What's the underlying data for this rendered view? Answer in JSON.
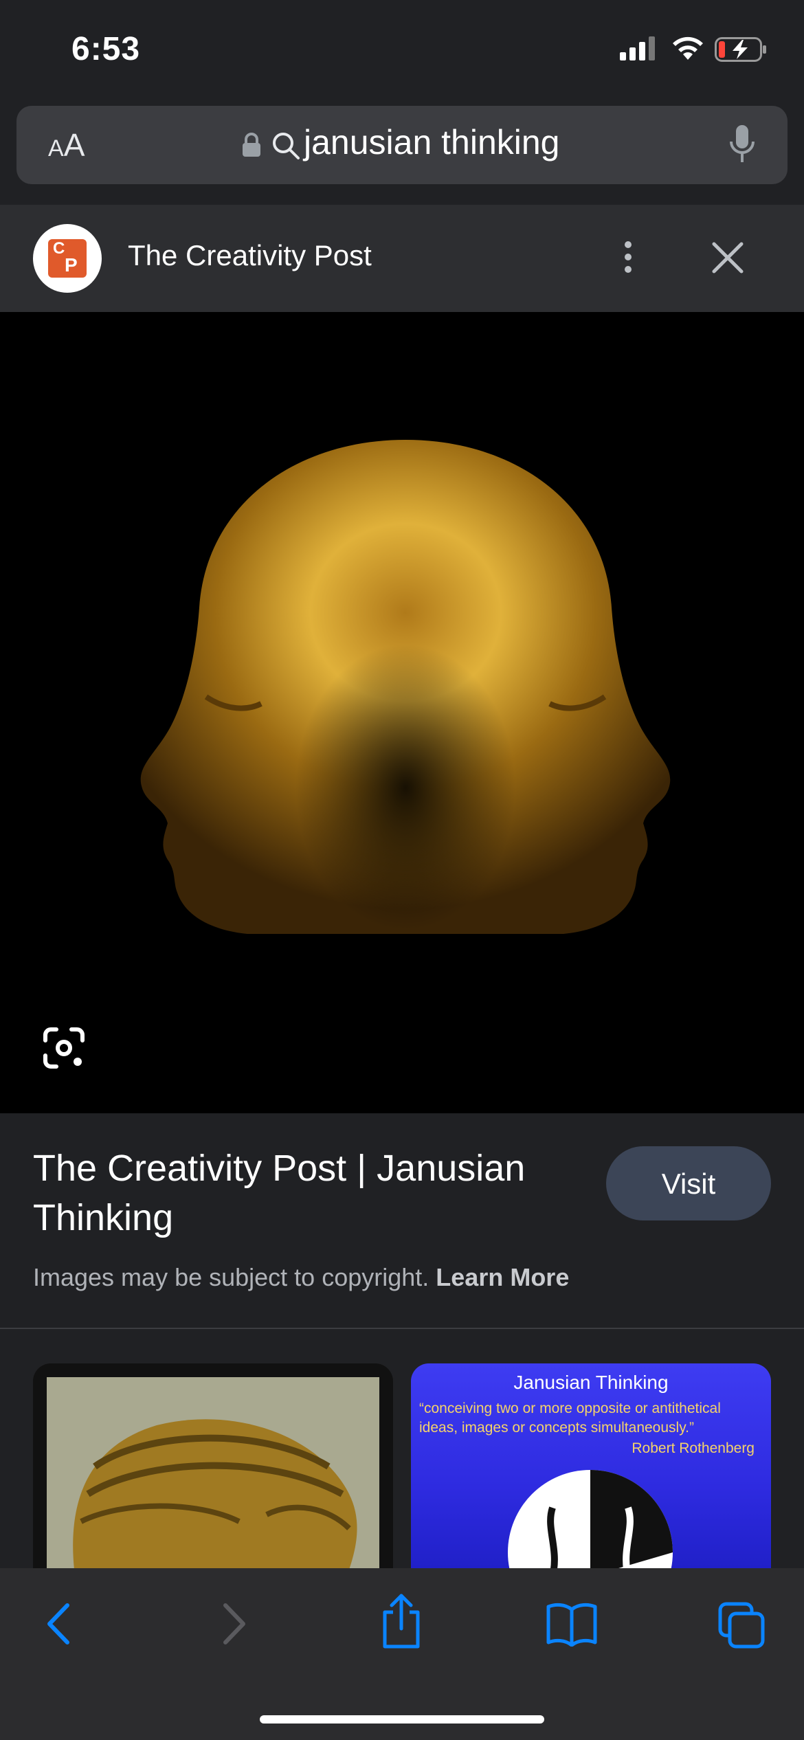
{
  "status": {
    "time": "6:53",
    "battery_color": "#ff453a"
  },
  "address_bar": {
    "text_size_label": "AA",
    "query": "janusian thinking",
    "icons": [
      "lock-icon",
      "search-icon",
      "microphone-icon"
    ]
  },
  "source": {
    "name": "The Creativity Post",
    "logo_letters": "CP",
    "logo_color": "#e05a2b"
  },
  "result": {
    "title": "The Creativity Post | Janusian Thinking",
    "visit_label": "Visit",
    "copyright_text": "Images may be subject to copyright.",
    "learn_more": "Learn More"
  },
  "related": [
    {
      "kind": "image",
      "description_icon": "golden-janus-head"
    },
    {
      "kind": "slide",
      "title": "Janusian Thinking",
      "quote": "“conceiving two or more opposite or antithetical ideas, images or concepts simultaneously.”",
      "author": "Robert Rothenberg"
    }
  ],
  "toolbar": {
    "icons": [
      "back-icon",
      "forward-icon",
      "share-icon",
      "bookmarks-icon",
      "tabs-icon"
    ],
    "accent_color": "#0a84ff"
  }
}
